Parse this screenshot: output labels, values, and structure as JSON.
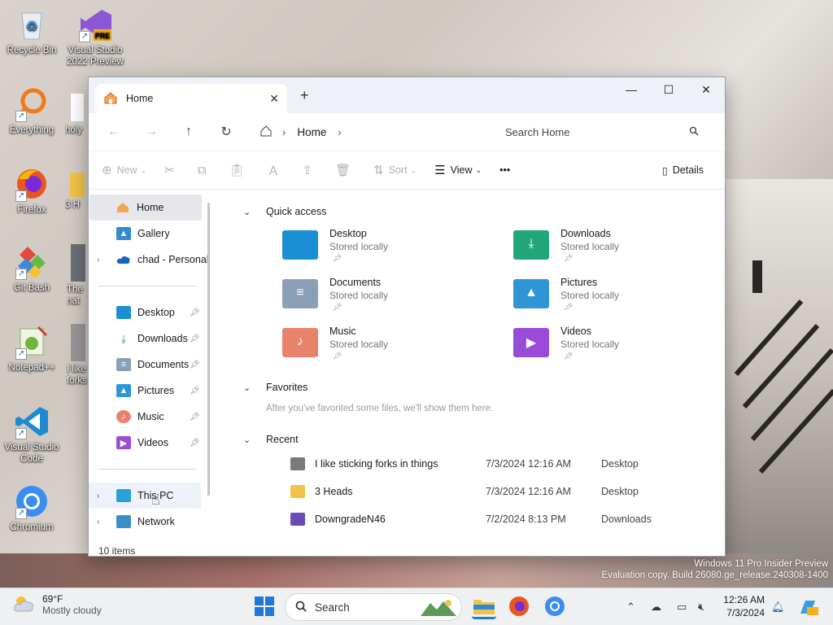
{
  "desktop": {
    "icons": [
      {
        "label": "Recycle Bin"
      },
      {
        "label": "Visual Studio 2022 Preview"
      },
      {
        "label": "Everything"
      },
      {
        "label": "holy"
      },
      {
        "label": "Firefox"
      },
      {
        "label": "3 H"
      },
      {
        "label": "Git Bash"
      },
      {
        "label": "The nat"
      },
      {
        "label": "Notepad++"
      },
      {
        "label": "I like forks"
      },
      {
        "label": "Visual Studio Code"
      },
      {
        "label": "Chromium"
      }
    ],
    "vs_badge": "PRE",
    "watermark": {
      "line1": "Windows 11 Pro Insider Preview",
      "line2": "Evaluation copy. Build 26080.ge_release.240308-1400"
    }
  },
  "window": {
    "tab_title": "Home",
    "breadcrumb": [
      "Home"
    ],
    "search_placeholder": "Search Home",
    "toolbar": {
      "new": "New",
      "sort": "Sort",
      "view": "View",
      "more": "•••",
      "details": "Details"
    },
    "sidebar": {
      "top": [
        {
          "label": "Home",
          "selected": true
        },
        {
          "label": "Gallery"
        },
        {
          "label": "chad - Personal"
        }
      ],
      "pinned": [
        {
          "label": "Desktop"
        },
        {
          "label": "Downloads"
        },
        {
          "label": "Documents"
        },
        {
          "label": "Pictures"
        },
        {
          "label": "Music"
        },
        {
          "label": "Videos"
        }
      ],
      "bottom": [
        {
          "label": "This PC"
        },
        {
          "label": "Network"
        }
      ]
    },
    "quick_access": {
      "heading": "Quick access",
      "items": [
        {
          "name": "Desktop",
          "status": "Stored locally",
          "color": "#1b8fd4"
        },
        {
          "name": "Downloads",
          "status": "Stored locally",
          "color": "#21a67a"
        },
        {
          "name": "Documents",
          "status": "Stored locally",
          "color": "#8aa0b8"
        },
        {
          "name": "Pictures",
          "status": "Stored locally",
          "color": "#2f95d6"
        },
        {
          "name": "Music",
          "status": "Stored locally",
          "color": "#e9826a"
        },
        {
          "name": "Videos",
          "status": "Stored locally",
          "color": "#9a4bd8"
        }
      ]
    },
    "favorites": {
      "heading": "Favorites",
      "empty_text": "After you've favorited some files, we'll show them here."
    },
    "recent": {
      "heading": "Recent",
      "rows": [
        {
          "name": "I like sticking forks in things",
          "date": "7/3/2024 12:16 AM",
          "location": "Desktop"
        },
        {
          "name": "3 Heads",
          "date": "7/3/2024 12:16 AM",
          "location": "Desktop"
        },
        {
          "name": "DowngradeN46",
          "date": "7/2/2024 8:13 PM",
          "location": "Downloads"
        }
      ]
    },
    "status": "10 items"
  },
  "taskbar": {
    "weather_temp": "69°F",
    "weather_desc": "Mostly cloudy",
    "search_placeholder": "Search",
    "time": "12:26 AM",
    "date": "7/3/2024"
  }
}
